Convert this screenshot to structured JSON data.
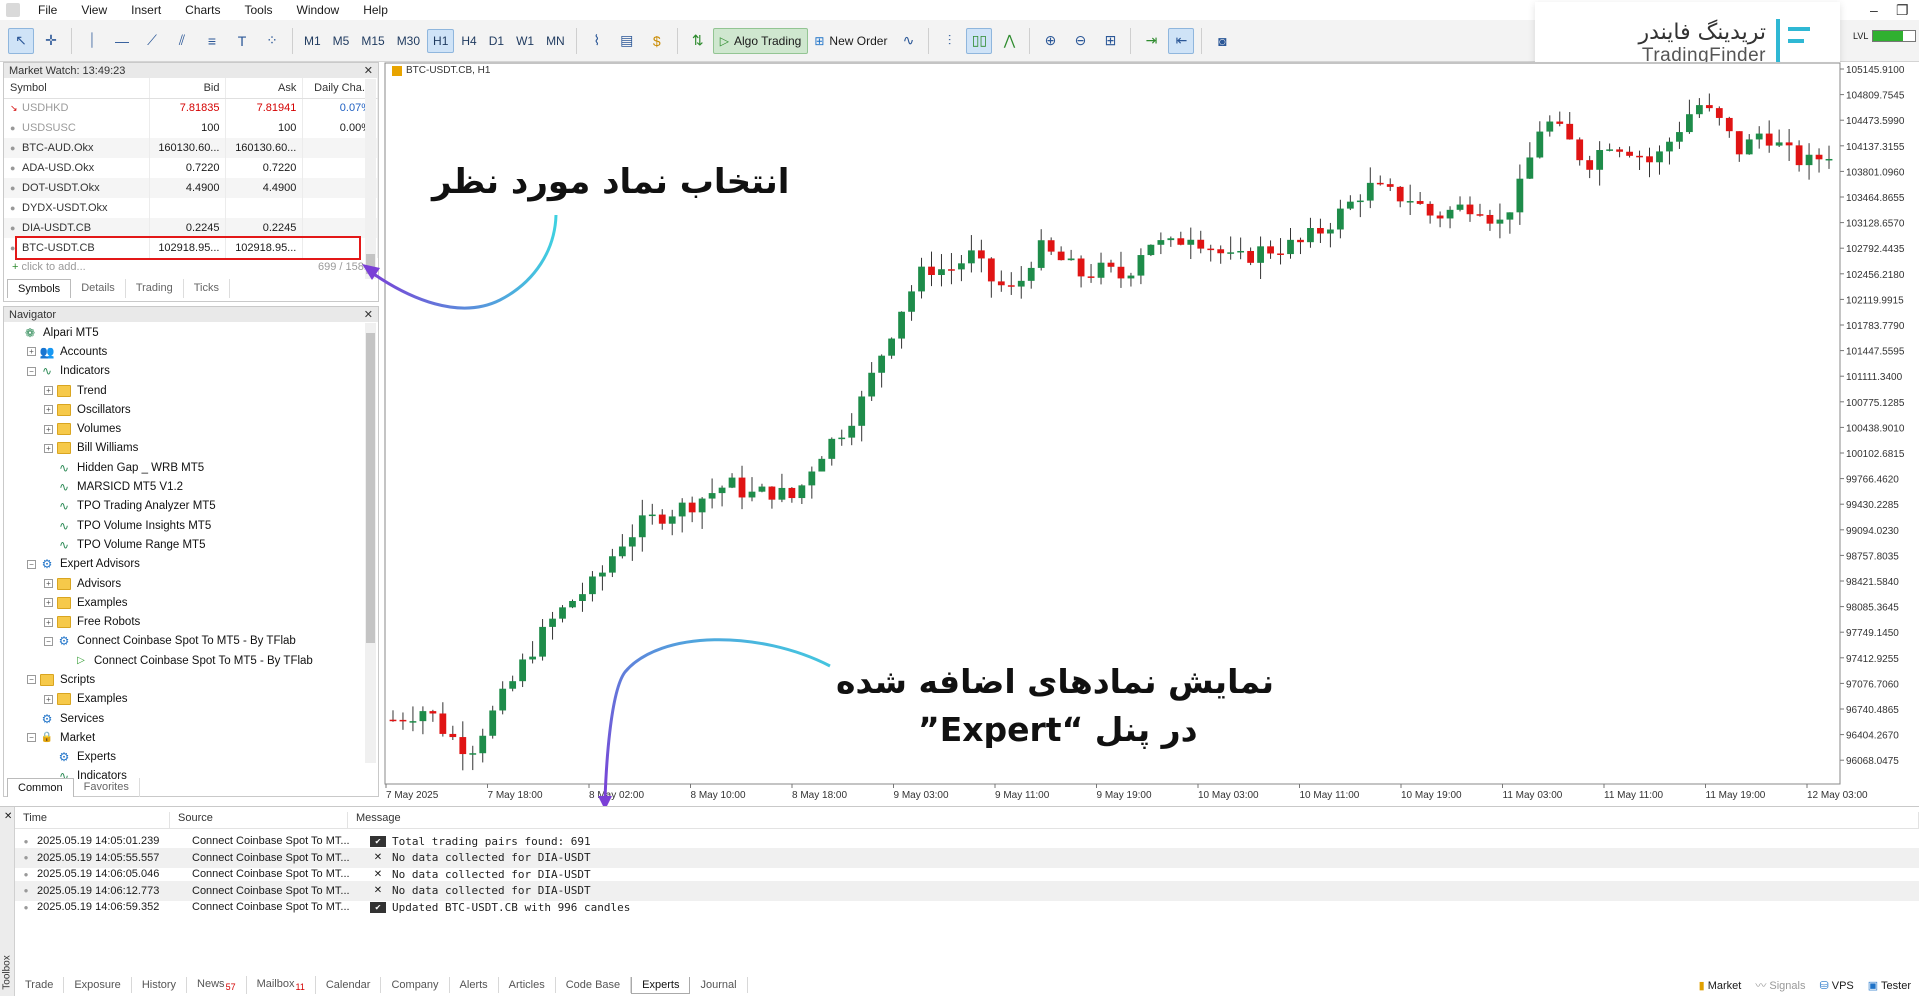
{
  "menu": [
    "File",
    "View",
    "Insert",
    "Charts",
    "Tools",
    "Window",
    "Help"
  ],
  "toolbar": {
    "timeframes": [
      "M1",
      "M5",
      "M15",
      "M30",
      "H1",
      "H4",
      "D1",
      "W1",
      "MN"
    ],
    "active_timeframe": "H1",
    "algo_trading": "Algo Trading",
    "new_order": "New Order"
  },
  "watermark": {
    "brand_fa": "تریدینگ فایندر",
    "brand_en": "TradingFinder",
    "indicator_label": "LVL"
  },
  "market_watch": {
    "title": "Market Watch: 13:49:23",
    "columns": [
      "Symbol",
      "Bid",
      "Ask",
      "Daily Cha..."
    ],
    "rows": [
      {
        "symbol": "USDHKD",
        "bid": "7.81835",
        "ask": "7.81941",
        "change": "0.07%"
      },
      {
        "symbol": "USDSUSC",
        "bid": "100",
        "ask": "100",
        "change": "0.00%"
      },
      {
        "symbol": "BTC-AUD.Okx",
        "bid": "160130.60...",
        "ask": "160130.60...",
        "change": ""
      },
      {
        "symbol": "ADA-USD.Okx",
        "bid": "0.7220",
        "ask": "0.7220",
        "change": ""
      },
      {
        "symbol": "DOT-USDT.Okx",
        "bid": "4.4900",
        "ask": "4.4900",
        "change": ""
      },
      {
        "symbol": "DYDX-USDT.Okx",
        "bid": "",
        "ask": "",
        "change": ""
      },
      {
        "symbol": "DIA-USDT.CB",
        "bid": "0.2245",
        "ask": "0.2245",
        "change": ""
      },
      {
        "symbol": "BTC-USDT.CB",
        "bid": "102918.95...",
        "ask": "102918.95...",
        "change": ""
      }
    ],
    "add_placeholder": "click to add...",
    "count": "699 / 1581",
    "tabs": [
      "Symbols",
      "Details",
      "Trading",
      "Ticks"
    ]
  },
  "navigator": {
    "title": "Navigator",
    "items": [
      {
        "label": "Alpari MT5",
        "level": 0,
        "icon": "broker-icon",
        "expander": "none"
      },
      {
        "label": "Accounts",
        "level": 1,
        "icon": "accounts-icon",
        "expander": "+"
      },
      {
        "label": "Indicators",
        "level": 1,
        "icon": "indicator-icon",
        "expander": "-"
      },
      {
        "label": "Trend",
        "level": 2,
        "icon": "folder-icon",
        "expander": "+"
      },
      {
        "label": "Oscillators",
        "level": 2,
        "icon": "folder-icon",
        "expander": "+"
      },
      {
        "label": "Volumes",
        "level": 2,
        "icon": "folder-icon",
        "expander": "+"
      },
      {
        "label": "Bill Williams",
        "level": 2,
        "icon": "folder-icon",
        "expander": "+"
      },
      {
        "label": "Hidden Gap _ WRB MT5",
        "level": 2,
        "icon": "indicator-icon",
        "expander": "none"
      },
      {
        "label": "MARSICD MT5 V1.2",
        "level": 2,
        "icon": "indicator-icon",
        "expander": "none"
      },
      {
        "label": "TPO Trading Analyzer MT5",
        "level": 2,
        "icon": "indicator-icon",
        "expander": "none"
      },
      {
        "label": "TPO Volume Insights MT5",
        "level": 2,
        "icon": "indicator-icon",
        "expander": "none"
      },
      {
        "label": "TPO Volume Range MT5",
        "level": 2,
        "icon": "indicator-icon",
        "expander": "none"
      },
      {
        "label": "Expert Advisors",
        "level": 1,
        "icon": "expert-icon",
        "expander": "-"
      },
      {
        "label": "Advisors",
        "level": 2,
        "icon": "folder-icon",
        "expander": "+"
      },
      {
        "label": "Examples",
        "level": 2,
        "icon": "folder-icon",
        "expander": "+"
      },
      {
        "label": "Free Robots",
        "level": 2,
        "icon": "folder-icon",
        "expander": "+"
      },
      {
        "label": "Connect Coinbase Spot To MT5 - By TFlab",
        "level": 2,
        "icon": "expert-icon",
        "expander": "-"
      },
      {
        "label": "Connect Coinbase Spot To MT5 - By TFlab",
        "level": 3,
        "icon": "play-icon",
        "expander": "none"
      },
      {
        "label": "Scripts",
        "level": 1,
        "icon": "folder-icon",
        "expander": "-"
      },
      {
        "label": "Examples",
        "level": 2,
        "icon": "folder-icon",
        "expander": "+"
      },
      {
        "label": "Services",
        "level": 1,
        "icon": "expert-icon",
        "expander": "none"
      },
      {
        "label": "Market",
        "level": 1,
        "icon": "market-icon",
        "expander": "-"
      },
      {
        "label": "Experts",
        "level": 2,
        "icon": "expert-icon",
        "expander": "none"
      },
      {
        "label": "Indicators",
        "level": 2,
        "icon": "indicator-icon",
        "expander": "none"
      }
    ],
    "tabs": [
      "Common",
      "Favorites"
    ]
  },
  "chart": {
    "caption": "BTC-USDT.CB, H1",
    "time_labels": [
      "7 May 2025",
      "7 May 18:00",
      "8 May 02:00",
      "8 May 10:00",
      "8 May 18:00",
      "9 May 03:00",
      "9 May 11:00",
      "9 May 19:00",
      "10 May 03:00",
      "10 May 11:00",
      "10 May 19:00",
      "11 May 03:00",
      "11 May 11:00",
      "11 May 19:00",
      "12 May 03:00"
    ],
    "price_labels": [
      "105145.9100",
      "104809.7545",
      "104473.5990",
      "104137.3155",
      "103801.0960",
      "103464.8655",
      "103128.6570",
      "102792.4435",
      "102456.2180",
      "102119.9915",
      "101783.7790",
      "101447.5595",
      "101111.3400",
      "100775.1285",
      "100438.9010",
      "100102.6815",
      "99766.4620",
      "99430.2285",
      "99094.0230",
      "98757.8035",
      "98421.5840",
      "98085.3645",
      "97749.1450",
      "97412.9255",
      "97076.7060",
      "96740.4865",
      "96404.2670",
      "96068.0475"
    ],
    "bull_color": "#1e8c4a",
    "bear_color": "#e01414"
  },
  "annotations": {
    "select_symbol": "انتخاب نماد مورد نظر",
    "show_line1": "نمایش نمادهای اضافه شده",
    "show_line2": "در پنل “Expert”",
    "arrow_color": "#7a3fd6",
    "arrow_color2": "#3fd0e0"
  },
  "toolbox": {
    "side_label": "Toolbox",
    "columns": [
      "Time",
      "Source",
      "Message"
    ],
    "rows": [
      {
        "time": "2025.05.19 14:05:01.239",
        "source": "Connect Coinbase Spot To MT...",
        "status": "ok",
        "message": "Total trading pairs found: 691"
      },
      {
        "time": "2025.05.19 14:05:55.557",
        "source": "Connect Coinbase Spot To MT...",
        "status": "x",
        "message": "No data collected for DIA-USDT"
      },
      {
        "time": "2025.05.19 14:06:05.046",
        "source": "Connect Coinbase Spot To MT...",
        "status": "x",
        "message": "No data collected for DIA-USDT"
      },
      {
        "time": "2025.05.19 14:06:12.773",
        "source": "Connect Coinbase Spot To MT...",
        "status": "x",
        "message": "No data collected for DIA-USDT"
      },
      {
        "time": "2025.05.19 14:06:59.352",
        "source": "Connect Coinbase Spot To MT...",
        "status": "ok",
        "message": "Updated BTC-USDT.CB with 996 candles"
      }
    ],
    "tabs": [
      {
        "label": "Trade",
        "badge": ""
      },
      {
        "label": "Exposure",
        "badge": ""
      },
      {
        "label": "History",
        "badge": ""
      },
      {
        "label": "News",
        "badge": "57"
      },
      {
        "label": "Mailbox",
        "badge": "11"
      },
      {
        "label": "Calendar",
        "badge": ""
      },
      {
        "label": "Company",
        "badge": ""
      },
      {
        "label": "Alerts",
        "badge": ""
      },
      {
        "label": "Articles",
        "badge": ""
      },
      {
        "label": "Code Base",
        "badge": ""
      },
      {
        "label": "Experts",
        "badge": ""
      },
      {
        "label": "Journal",
        "badge": ""
      }
    ],
    "active_tab": "Experts",
    "status_items": [
      "Market",
      "Signals",
      "VPS",
      "Tester"
    ]
  }
}
